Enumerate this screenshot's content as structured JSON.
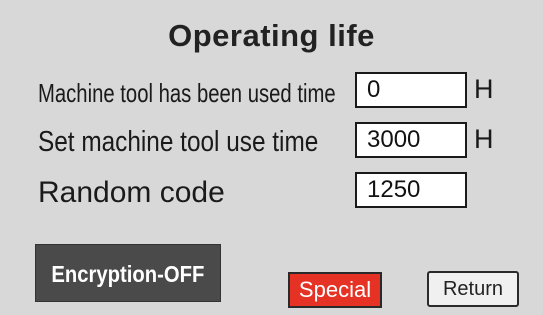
{
  "title": "Operating life",
  "rows": [
    {
      "label": "Machine tool has been used time",
      "value": "0",
      "unit": "H"
    },
    {
      "label": "Set machine tool use time",
      "value": "3000",
      "unit": "H"
    },
    {
      "label": "Random code",
      "value": "1250"
    }
  ],
  "buttons": {
    "encryption": "Encryption-OFF",
    "special": "Special",
    "return": "Return"
  },
  "colors": {
    "background": "#d8d8d8",
    "encryption_button": "#4a4a4a",
    "special_button": "#e53224"
  }
}
